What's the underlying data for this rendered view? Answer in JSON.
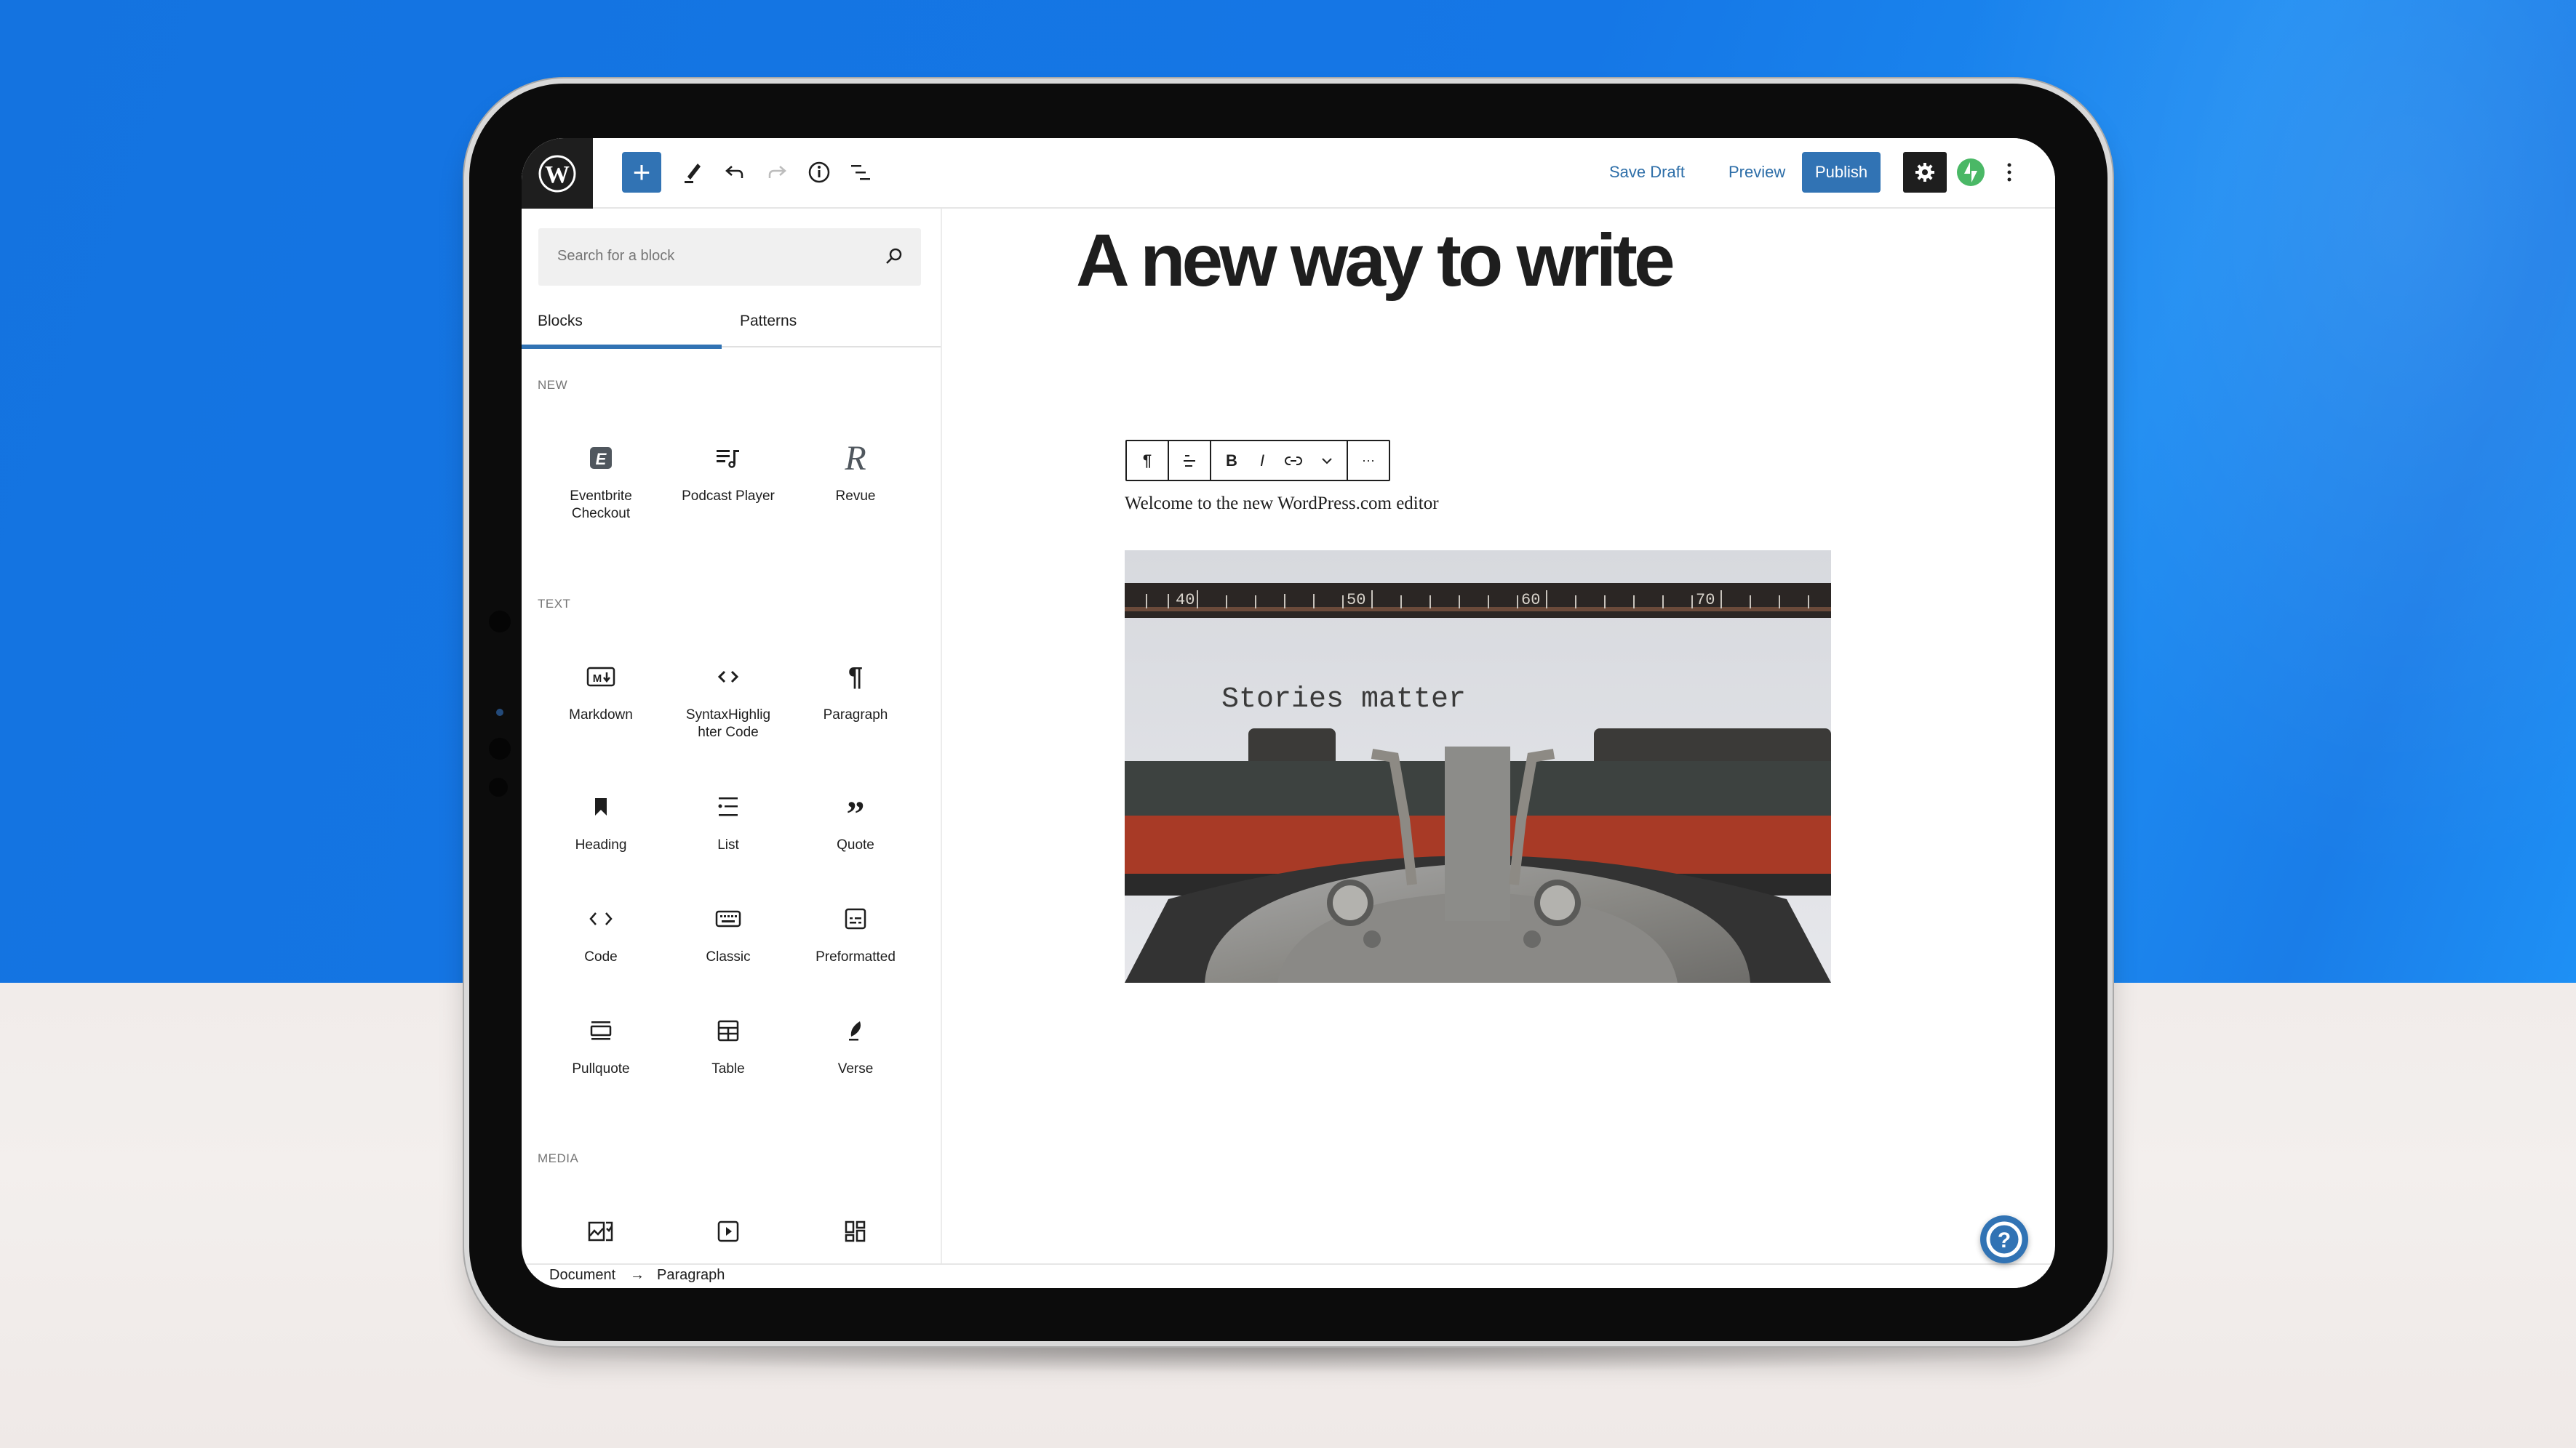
{
  "colors": {
    "accent": "#3173b4",
    "dark": "#1e1e1e",
    "jetpack": "#4ab866",
    "wall_blue": "#1473e0",
    "desk": "#f3efed"
  },
  "header": {
    "logo": "wordpress-logo",
    "inserter_label": "+",
    "tools": [
      "edit-pencil",
      "undo",
      "redo",
      "info",
      "list-view"
    ],
    "save_draft": "Save Draft",
    "preview": "Preview",
    "publish": "Publish",
    "settings_icon": "gear",
    "jetpack_icon": "jetpack-bolt",
    "more_icon": "vertical-ellipsis"
  },
  "sidebar": {
    "search_placeholder": "Search for a block",
    "tabs": [
      {
        "label": "Blocks",
        "active": true
      },
      {
        "label": "Patterns",
        "active": false
      }
    ],
    "categories": [
      {
        "name": "NEW",
        "blocks": [
          {
            "label": "Eventbrite Checkout",
            "icon": "eventbrite"
          },
          {
            "label": "Podcast Player",
            "icon": "podcast-player"
          },
          {
            "label": "Revue",
            "icon": "revue"
          }
        ]
      },
      {
        "name": "TEXT",
        "blocks": [
          {
            "label": "Markdown",
            "icon": "markdown"
          },
          {
            "label": "SyntaxHighlighter Code",
            "icon": "syntax-code"
          },
          {
            "label": "Paragraph",
            "icon": "pilcrow"
          },
          {
            "label": "Heading",
            "icon": "bookmark"
          },
          {
            "label": "List",
            "icon": "list"
          },
          {
            "label": "Quote",
            "icon": "quote"
          },
          {
            "label": "Code",
            "icon": "code"
          },
          {
            "label": "Classic",
            "icon": "keyboard"
          },
          {
            "label": "Preformatted",
            "icon": "preformatted"
          },
          {
            "label": "Pullquote",
            "icon": "pullquote"
          },
          {
            "label": "Table",
            "icon": "table"
          },
          {
            "label": "Verse",
            "icon": "feather"
          }
        ]
      },
      {
        "name": "MEDIA",
        "blocks": [
          {
            "label": "",
            "icon": "image"
          },
          {
            "label": "",
            "icon": "video"
          },
          {
            "label": "",
            "icon": "gallery"
          }
        ]
      }
    ]
  },
  "footer": {
    "breadcrumb": [
      "Document",
      "Paragraph"
    ],
    "separator": "→"
  },
  "canvas": {
    "title": "A new way to write",
    "block_toolbar": [
      "paragraph",
      "align",
      "bold",
      "italic",
      "link",
      "more-formats",
      "options"
    ],
    "toolbar_labels": {
      "paragraph": "¶",
      "bold": "B",
      "italic": "I",
      "options": "···"
    },
    "paragraph": "Welcome to the new WordPress.com editor",
    "image_caption_text": "Stories matter",
    "image_ruler_numbers": [
      "40",
      "50",
      "60",
      "70"
    ],
    "help_icon": "help"
  }
}
